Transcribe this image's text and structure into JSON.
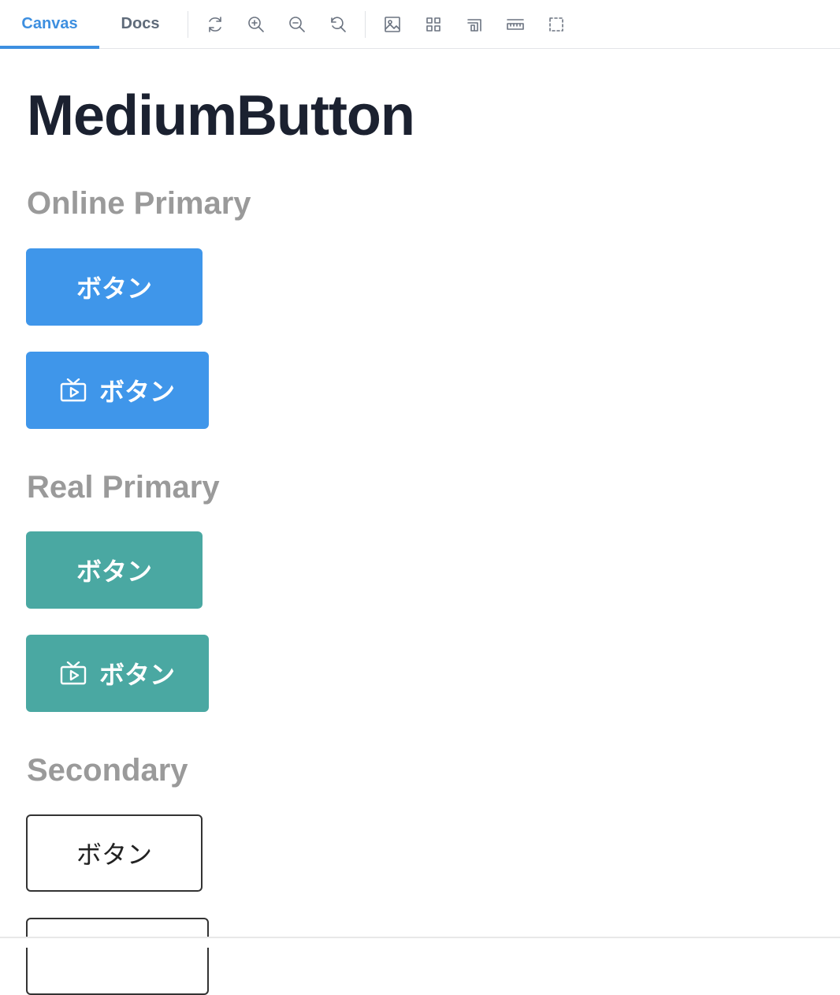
{
  "toolbar": {
    "tabs": [
      {
        "label": "Canvas",
        "active": true
      },
      {
        "label": "Docs",
        "active": false
      }
    ],
    "tools": [
      "refresh-icon",
      "zoom-in-icon",
      "zoom-out-icon",
      "reset-zoom-icon",
      "background-icon",
      "grid-icon",
      "viewport-icon",
      "ruler-icon",
      "outline-icon"
    ]
  },
  "page": {
    "title": "MediumButton"
  },
  "sections": [
    {
      "title": "Online Primary",
      "buttons": [
        {
          "label": "ボタン",
          "icon": null
        },
        {
          "label": "ボタン",
          "icon": "tv-play-icon"
        }
      ]
    },
    {
      "title": "Real Primary",
      "buttons": [
        {
          "label": "ボタン",
          "icon": null
        },
        {
          "label": "ボタン",
          "icon": "tv-play-icon"
        }
      ]
    },
    {
      "title": "Secondary",
      "buttons": [
        {
          "label": "ボタン",
          "icon": null
        },
        {
          "label": "",
          "icon": null
        }
      ]
    }
  ],
  "colors": {
    "accent": "#3d8fe0",
    "online_primary": "#3f96ea",
    "real_primary": "#4aa8a2",
    "section_title": "#9a9a9a",
    "page_title": "#1b2130"
  }
}
